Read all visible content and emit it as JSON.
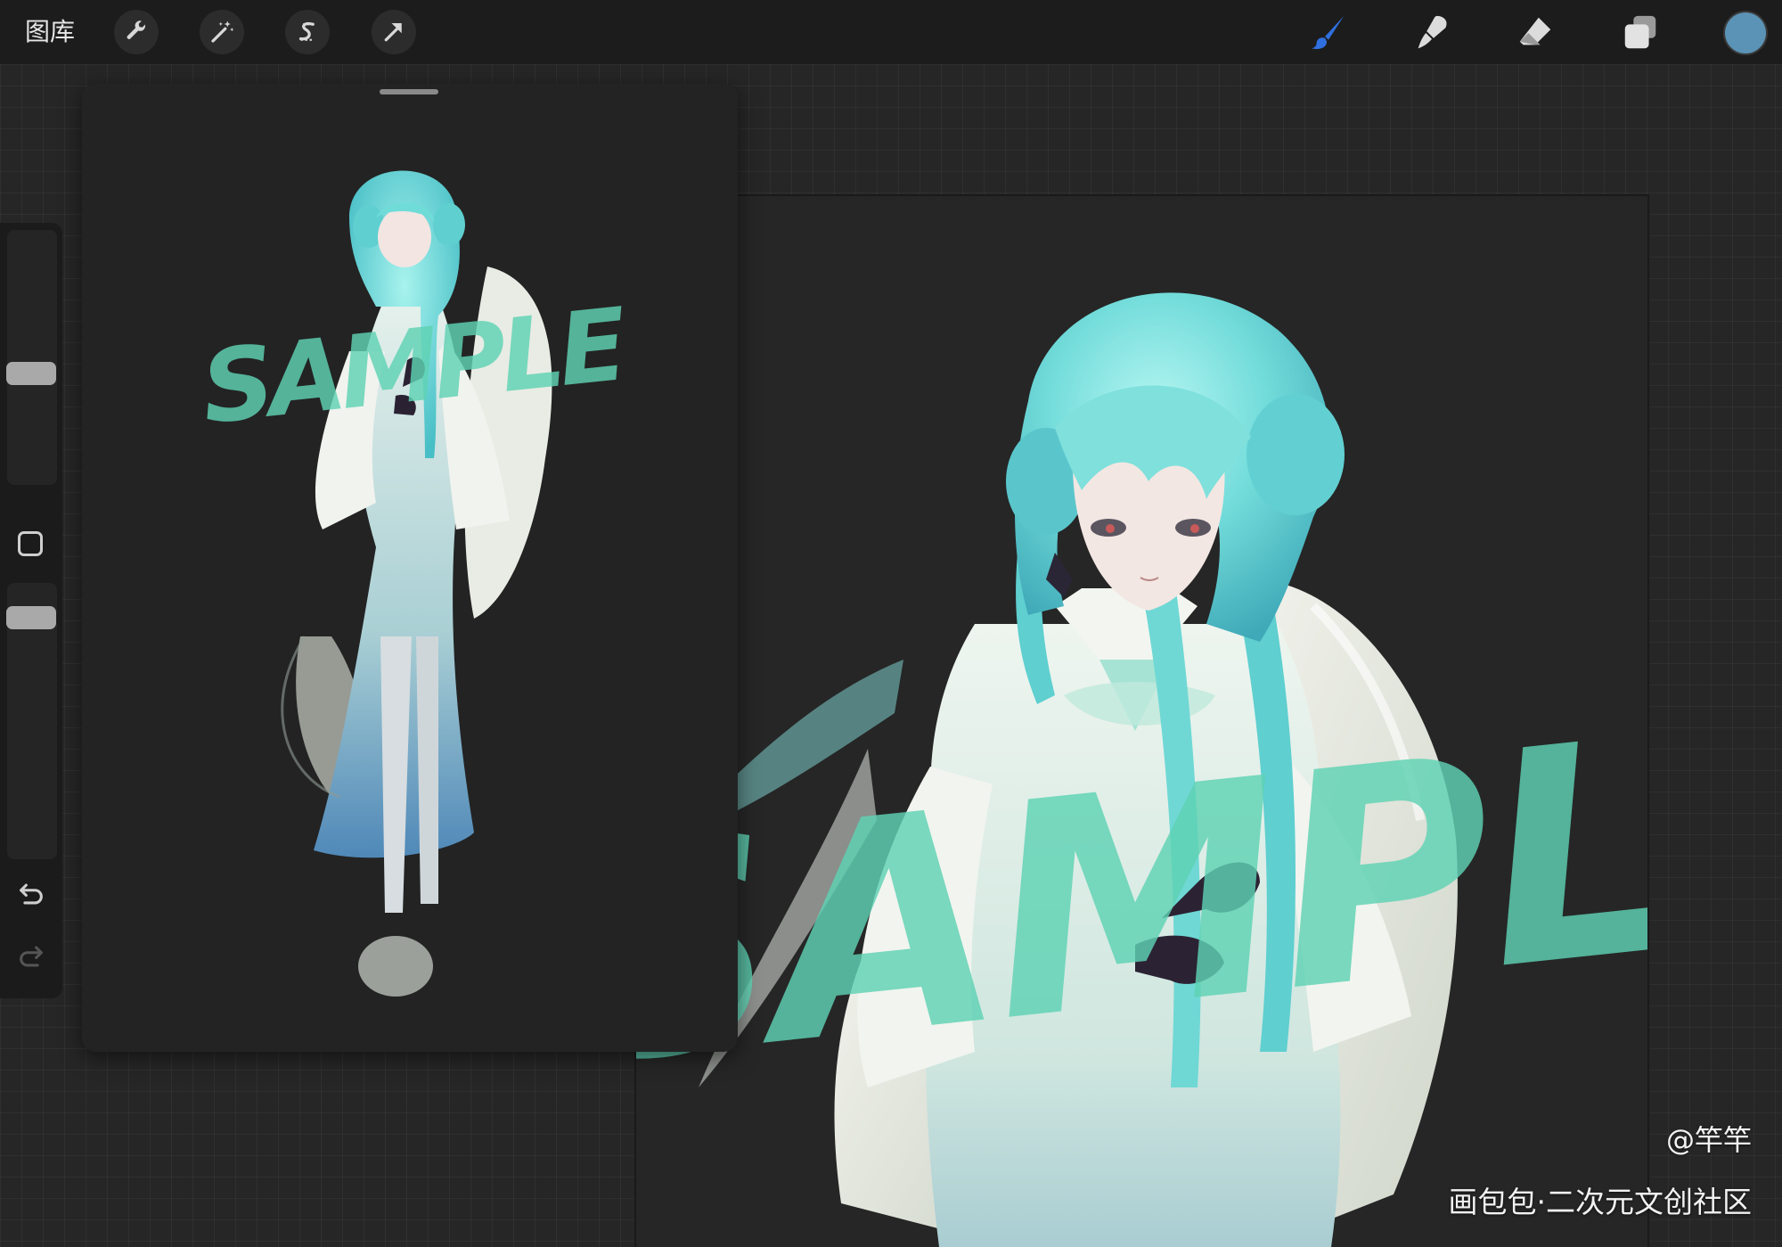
{
  "toolbar": {
    "gallery_label": "图库",
    "left_tools": [
      {
        "name": "actions",
        "icon": "wrench-icon"
      },
      {
        "name": "adjustments",
        "icon": "magic-wand-icon"
      },
      {
        "name": "selection",
        "icon": "selection-s-icon"
      },
      {
        "name": "transform",
        "icon": "arrow-cursor-icon"
      }
    ],
    "right_tools": [
      {
        "name": "brush",
        "icon": "brush-icon",
        "active": true
      },
      {
        "name": "smudge",
        "icon": "smudge-icon"
      },
      {
        "name": "eraser",
        "icon": "eraser-icon"
      },
      {
        "name": "layers",
        "icon": "layers-icon"
      }
    ],
    "current_color": "#5b93b6",
    "active_color": "#2f6fe0"
  },
  "sidebar": {
    "brush_size_level": 0.42,
    "opacity_level": 0.92,
    "undo_icon": "undo-icon",
    "redo_icon": "redo-icon"
  },
  "reference": {
    "watermark_text": "SAMPLE"
  },
  "canvas": {
    "watermark_text": "SAMPLE",
    "overlay_color": "#5fd3b4"
  },
  "watermark": {
    "author": "@竿竿",
    "site": "画包包·二次元文创社区"
  }
}
